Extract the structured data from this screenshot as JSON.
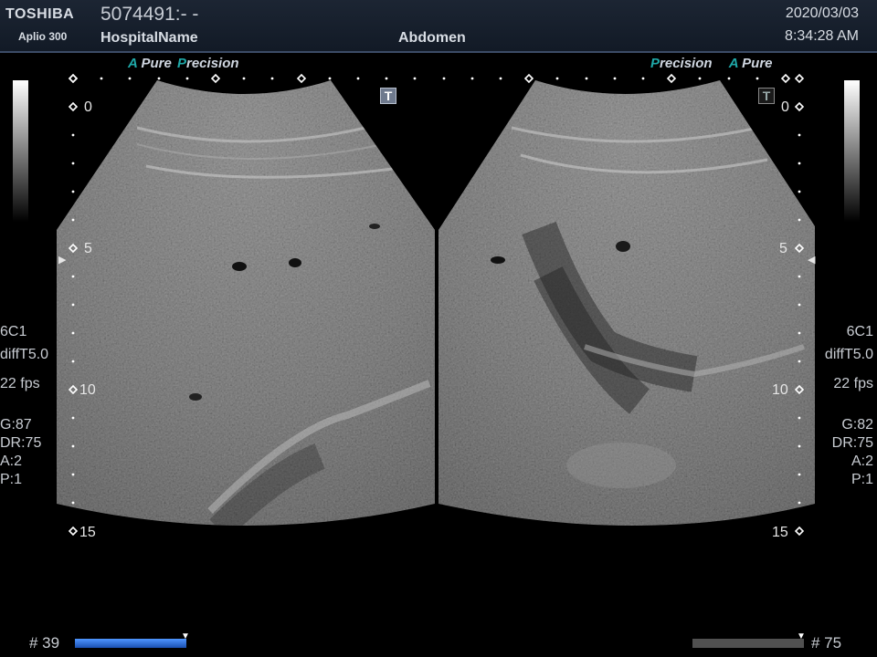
{
  "header": {
    "brand": "TOSHIBA",
    "model": "Aplio 300",
    "patient_id": "5074491:- -",
    "hospital_name": "HospitalName",
    "exam_type": "Abdomen",
    "date": "2020/03/03",
    "time": "8:34:28 AM"
  },
  "left_panel": {
    "tag_a": "A",
    "tag_pure": "Pure",
    "tag_p": "P",
    "tag_precision": "recision",
    "t_button": "T",
    "depth_labels": [
      "0",
      "5",
      "10",
      "15"
    ],
    "probe": "6C1",
    "mode": "diffT5.0",
    "fps": "22 fps",
    "gain": "G:87",
    "dynamic_range": "DR:75",
    "acoustic": "A:2",
    "persistence": "P:1",
    "frame_number": "# 39",
    "cine_progress": 1.0
  },
  "right_panel": {
    "tag_p": "P",
    "tag_precision": "recision",
    "tag_a": "A",
    "tag_pure": "Pure",
    "t_button": "T",
    "depth_labels": [
      "0",
      "5",
      "10",
      "15"
    ],
    "probe": "6C1",
    "mode": "diffT5.0",
    "fps": "22 fps",
    "gain": "G:82",
    "dynamic_range": "DR:75",
    "acoustic": "A:2",
    "persistence": "P:1",
    "frame_number": "# 75",
    "cine_progress": 1.0
  },
  "colors": {
    "header_bg": "#1a2230",
    "accent_teal": "#1fa8a8",
    "cine_active": "#2f7cf0",
    "cine_inactive": "#505050"
  },
  "icons": {
    "depth_marker": "diamond-icon",
    "focus_marker": "triangle-right-icon",
    "cine_marker": "triangle-down-icon"
  }
}
